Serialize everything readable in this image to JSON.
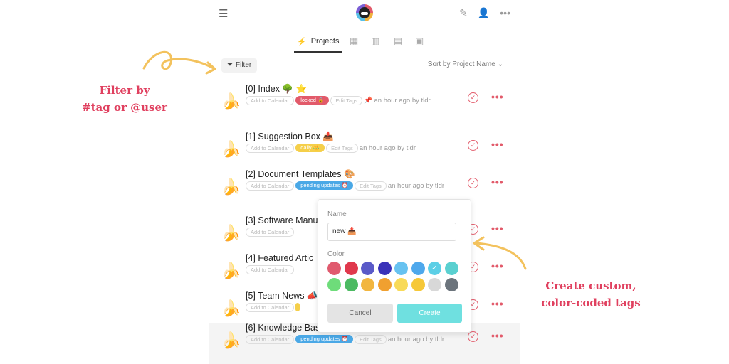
{
  "toolbar": {
    "menu_icon": "hamburger-icon",
    "right_icons": [
      "compose-icon",
      "add-user-icon",
      "more-icon"
    ]
  },
  "tabs": {
    "active_label": "Projects",
    "icons": [
      "calendar-icon",
      "map-icon",
      "document-icon",
      "archive-icon"
    ]
  },
  "filter": {
    "label": "Filter"
  },
  "sort": {
    "label": "Sort by Project Name"
  },
  "chips": {
    "add_calendar": "Add to Calendar",
    "edit_tags": "Edit Tags"
  },
  "projects": [
    {
      "title": "[0] Index 🌳 ⭐",
      "tag": "locked 🔒",
      "tag_color": "#e25a6a",
      "meta": "📌 an hour ago by tldr"
    },
    {
      "title": "[1] Suggestion Box 📥",
      "tag": "daily 👑",
      "tag_color": "#f5cf4a",
      "meta": "an hour ago by tldr"
    },
    {
      "title": "[2] Document Templates 🎨",
      "tag": "pending updates ⏰",
      "tag_color": "#4aa8e6",
      "meta": "an hour ago by tldr"
    },
    {
      "title": "[3] Software Manu",
      "tag": "",
      "tag_color": "",
      "meta": ""
    },
    {
      "title": "[4] Featured Artic",
      "tag": "",
      "tag_color": "",
      "meta": ""
    },
    {
      "title": "[5] Team News 📣",
      "tag": "",
      "tag_color": "#f5cf4a",
      "meta": ""
    },
    {
      "title": "[6] Knowledge Base 💡",
      "tag": "pending updates ⏰",
      "tag_color": "#4aa8e6",
      "meta": "an hour ago by tldr"
    }
  ],
  "popup": {
    "name_label": "Name",
    "name_value": "new 📥",
    "color_label": "Color",
    "colors_row1": [
      "#e05a6e",
      "#e0384c",
      "#5a5ac8",
      "#3a32b8",
      "#67c2f0",
      "#4ea8ec",
      "#5ccfe6",
      "#5ad0d0"
    ],
    "colors_row2": [
      "#6edc7a",
      "#4cba62",
      "#f2b640",
      "#f0a030",
      "#f8da58",
      "#f6c838",
      "#d8d8d8",
      "#6c747c"
    ],
    "selected_color": "#5ccfe6",
    "cancel_label": "Cancel",
    "create_label": "Create"
  },
  "callouts": {
    "left_line1": "Filter by",
    "left_line2": "#tag or @user",
    "right_line1": "Create custom,",
    "right_line2": "color-coded tags",
    "accent_color": "#e0405f",
    "arrow_color": "#f3c25d"
  }
}
